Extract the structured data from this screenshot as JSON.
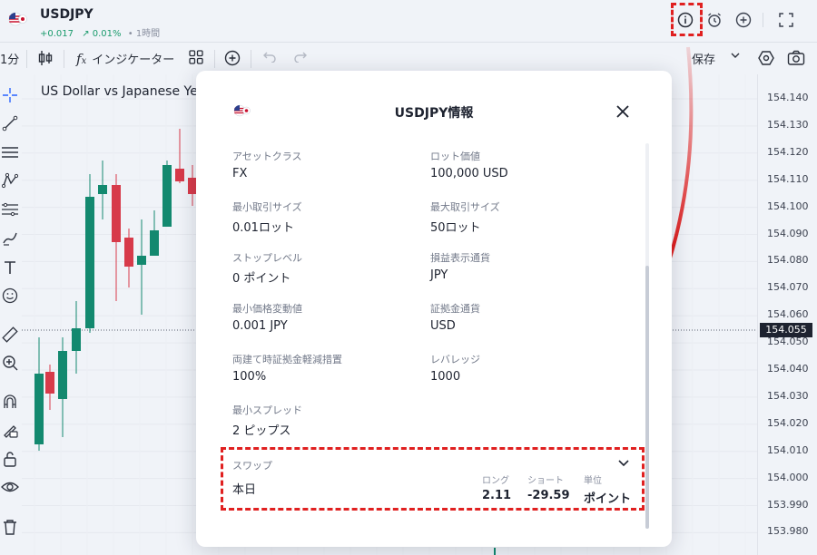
{
  "header": {
    "symbol": "USDJPY",
    "change": "+0.017",
    "change_pct": "↗ 0.01%",
    "timeframe": "1時間",
    "separator": "•",
    "icons": [
      "info-icon",
      "alarm-icon",
      "add-circle-icon",
      "fullscreen-icon"
    ]
  },
  "toolbar": {
    "timeframe": "1分",
    "indicators_label": "インジケーター",
    "save_label": "保存"
  },
  "chart": {
    "title": "US Dollar vs Japanese Ye",
    "current_price": "154.055",
    "price_labels": [
      "154.140",
      "154.130",
      "154.120",
      "154.110",
      "154.100",
      "154.090",
      "154.080",
      "154.070",
      "154.060",
      "154.050",
      "154.040",
      "154.030",
      "154.020",
      "154.010",
      "154.000",
      "153.990",
      "153.980"
    ]
  },
  "modal": {
    "title": "USDJPY情報",
    "fields": [
      {
        "label": "アセットクラス",
        "value": "FX"
      },
      {
        "label": "ロット価値",
        "value": "100,000 USD"
      },
      {
        "label": "最小取引サイズ",
        "value": "0.01ロット"
      },
      {
        "label": "最大取引サイズ",
        "value": "50ロット"
      },
      {
        "label": "ストップレベル",
        "value": "0 ポイント"
      },
      {
        "label": "損益表示通貨",
        "value": "JPY"
      },
      {
        "label": "最小価格変動値",
        "value": "0.001 JPY"
      },
      {
        "label": "証拠金通貨",
        "value": "USD"
      },
      {
        "label": "両建て時証拠金軽減措置",
        "value": "100%"
      },
      {
        "label": "レバレッジ",
        "value": "1000"
      },
      {
        "label": "最小スプレッド",
        "value": "2 ピップス"
      }
    ],
    "swap": {
      "label": "スワップ",
      "row_label": "本日",
      "long_header": "ロング",
      "long_value": "2.11",
      "short_header": "ショート",
      "short_value": "-29.59",
      "unit_header": "単位",
      "unit_value": "ポイント"
    }
  },
  "colors": {
    "up_candle": "#13896f",
    "down_candle": "#d73a4a",
    "highlight": "#e02020"
  }
}
